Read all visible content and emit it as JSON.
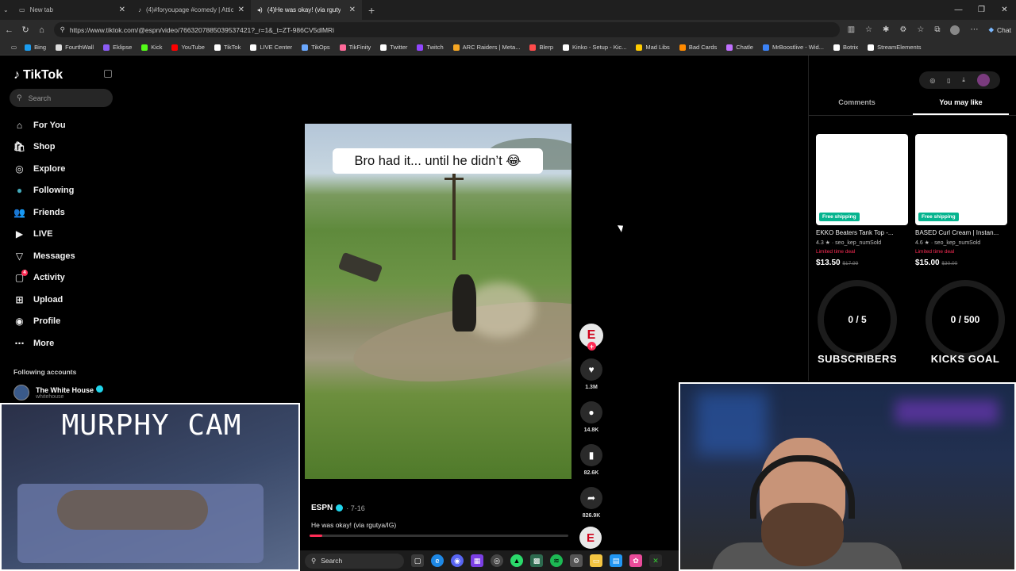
{
  "browser": {
    "tabs": [
      {
        "title": "New tab",
        "active": false
      },
      {
        "title": "(4)#foryoupage #comedy | Atticus",
        "active": false
      },
      {
        "title": "(4)He was okay! (via rgutya/IG",
        "active": true
      }
    ],
    "url": "https://www.tiktok.com/@espn/video/7663207885039537421?_r=1&_t=ZT-986CV5dlMRi",
    "chat_label": "Chat",
    "bookmarks": [
      {
        "label": "Bing",
        "color": "#1b9df0"
      },
      {
        "label": "FourthWall",
        "color": "#dddddd"
      },
      {
        "label": "Eklipse",
        "color": "#8b5cf6"
      },
      {
        "label": "Kick",
        "color": "#53fc18"
      },
      {
        "label": "YouTube",
        "color": "#ff0000"
      },
      {
        "label": "TikTok",
        "color": "#ffffff"
      },
      {
        "label": "LIVE Center",
        "color": "#ffffff"
      },
      {
        "label": "TikOps",
        "color": "#6aa8ff"
      },
      {
        "label": "TikFinity",
        "color": "#ff6a9a"
      },
      {
        "label": "Twitter",
        "color": "#ffffff"
      },
      {
        "label": "Twitch",
        "color": "#9146ff"
      },
      {
        "label": "ARC Raiders | Meta...",
        "color": "#f5a623"
      },
      {
        "label": "Blerp",
        "color": "#ff4b4b"
      },
      {
        "label": "Kinko - Setup - Kic...",
        "color": "#ffffff"
      },
      {
        "label": "Mad Libs",
        "color": "#ffcc00"
      },
      {
        "label": "Bad Cards",
        "color": "#ff8a00"
      },
      {
        "label": "Chatle",
        "color": "#c070ff"
      },
      {
        "label": "MrBoostlive - Wid...",
        "color": "#3b82f6"
      },
      {
        "label": "Botrix",
        "color": "#ffffff"
      },
      {
        "label": "StreamElements",
        "color": "#ffffff"
      }
    ]
  },
  "tiktok": {
    "brand": "TikTok",
    "search_placeholder": "Search",
    "menu": [
      {
        "label": "For You",
        "icon": "home-icon"
      },
      {
        "label": "Shop",
        "icon": "shop-icon"
      },
      {
        "label": "Explore",
        "icon": "compass-icon"
      },
      {
        "label": "Following",
        "icon": "following-avatar-icon"
      },
      {
        "label": "Friends",
        "icon": "friends-icon"
      },
      {
        "label": "LIVE",
        "icon": "live-icon"
      },
      {
        "label": "Messages",
        "icon": "messages-icon"
      },
      {
        "label": "Activity",
        "icon": "activity-icon",
        "badge": "4"
      },
      {
        "label": "Upload",
        "icon": "upload-icon"
      },
      {
        "label": "Profile",
        "icon": "profile-icon"
      },
      {
        "label": "More",
        "icon": "more-icon"
      }
    ],
    "following_accounts_label": "Following accounts",
    "following_account": {
      "name": "The White House",
      "handle": "whitehouse"
    }
  },
  "video": {
    "caption_overlay": "Bro had it... until he didn’t 😂",
    "author": "ESPN",
    "date": "· 7-16",
    "description": "He was okay! (via rgutya/IG)",
    "progress": 0.05,
    "author_initial": "E",
    "actions": {
      "likes": "1.3M",
      "comments": "14.8K",
      "saves": "82.6K",
      "shares": "826.9K"
    }
  },
  "right_panel": {
    "tabs": [
      {
        "label": "Comments",
        "active": false
      },
      {
        "label": "You may like",
        "active": true
      }
    ],
    "products": [
      {
        "badge": "Free shipping",
        "title": "EKKO Beaters Tank Top -...",
        "rating": "4.3 ★",
        "sold": "· seo_kep_numSold",
        "deal": "Limited time deal",
        "price": "$13.50",
        "old_price": "$17.99"
      },
      {
        "badge": "Free shipping",
        "title": "BASED Curl Cream | Instan...",
        "rating": "4.6 ★",
        "sold": "· seo_kep_numSold",
        "deal": "Limited time deal",
        "price": "$15.00",
        "old_price": "$30.00"
      }
    ]
  },
  "overlays": {
    "subscribers": {
      "value": "0 / 5",
      "label": "SUBSCRIBERS"
    },
    "kicks_goal": {
      "value": "0 / 500",
      "label": "KICKS GOAL"
    },
    "murphy_cam_title": "MURPHY CAM"
  },
  "taskbar": {
    "search_label": "Search"
  }
}
